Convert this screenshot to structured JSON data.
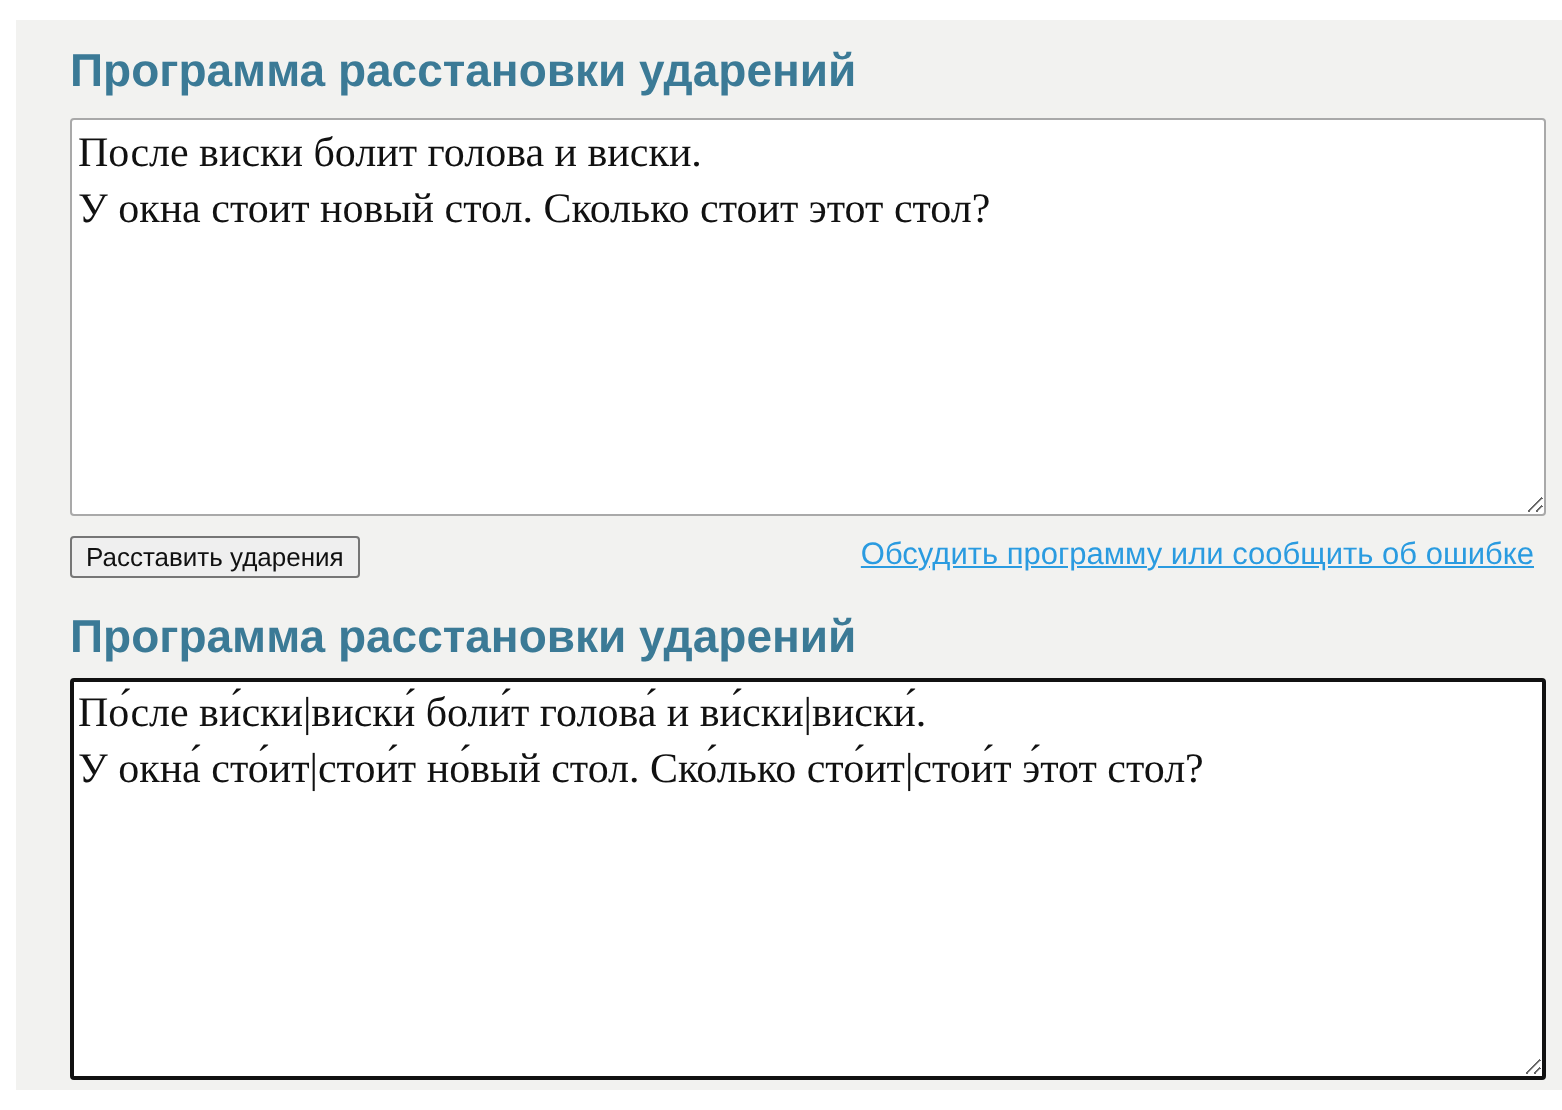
{
  "sections": [
    {
      "heading": "Программа расстановки ударений",
      "text": "После виски болит голова и виски.\nУ окна стоит новый стол. Сколько стоит этот стол?",
      "focused": false,
      "button": "Расставить ударения",
      "link": "Обсудить программу или сообщить об ошибке"
    },
    {
      "heading": "Программа расстановки ударений",
      "text": "По́сле ви́ски|виски́ боли́т голова́ и ви́ски|виски́.\nУ окна́ сто́ит|стои́т но́вый стол. Ско́лько сто́ит|стои́т э́тот стол?",
      "focused": true
    }
  ]
}
